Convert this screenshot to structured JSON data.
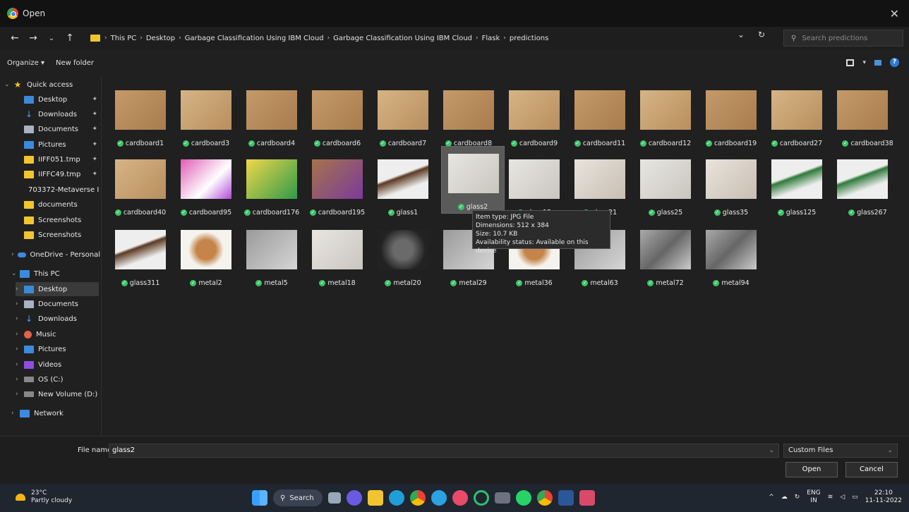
{
  "window": {
    "title": "Open"
  },
  "breadcrumb": {
    "segments": [
      "This PC",
      "Desktop",
      "Garbage Classification Using IBM Cloud",
      "Garbage Classification Using IBM Cloud",
      "Flask",
      "predictions"
    ]
  },
  "search": {
    "placeholder": "Search predictions"
  },
  "toolbar": {
    "organize": "Organize ▾",
    "new_folder": "New folder"
  },
  "sidebar": {
    "items": [
      {
        "label": "Quick access",
        "icon": "star-icon"
      },
      {
        "label": "Desktop",
        "icon": "desktop-icon",
        "pinned": true
      },
      {
        "label": "Downloads",
        "icon": "download-icon",
        "pinned": true
      },
      {
        "label": "Documents",
        "icon": "documents-icon",
        "pinned": true
      },
      {
        "label": "Pictures",
        "icon": "pictures-icon",
        "pinned": true
      },
      {
        "label": "IIFF051.tmp",
        "icon": "folder-icon",
        "pinned": true
      },
      {
        "label": "IIFFC49.tmp",
        "icon": "folder-icon",
        "pinned": true
      },
      {
        "label": "703372-Metaverse I",
        "icon": "folder-icon"
      },
      {
        "label": "documents",
        "icon": "folder-icon"
      },
      {
        "label": "Screenshots",
        "icon": "folder-icon"
      },
      {
        "label": "Screenshots",
        "icon": "folder-icon"
      },
      {
        "label": "OneDrive - Personal",
        "icon": "cloud-icon"
      },
      {
        "label": "This PC",
        "icon": "pc-icon"
      },
      {
        "label": "Desktop",
        "icon": "desktop-icon"
      },
      {
        "label": "Documents",
        "icon": "documents-icon"
      },
      {
        "label": "Downloads",
        "icon": "download-icon"
      },
      {
        "label": "Music",
        "icon": "music-icon"
      },
      {
        "label": "Pictures",
        "icon": "pictures-icon"
      },
      {
        "label": "Videos",
        "icon": "videos-icon"
      },
      {
        "label": "OS (C:)",
        "icon": "drive-icon"
      },
      {
        "label": "New Volume (D:)",
        "icon": "drive-icon"
      },
      {
        "label": "Network",
        "icon": "network-icon"
      }
    ]
  },
  "files": [
    "cardboard1",
    "cardboard3",
    "cardboard4",
    "cardboard6",
    "cardboard7",
    "cardboard8",
    "cardboard9",
    "cardboard11",
    "cardboard12",
    "cardboard19",
    "cardboard27",
    "cardboard38",
    "cardboard40",
    "cardboard95",
    "cardboard176",
    "cardboard195",
    "glass1",
    "glass2",
    "glass12",
    "glass21",
    "glass25",
    "glass35",
    "glass125",
    "glass267",
    "glass311",
    "metal2",
    "metal5",
    "metal18",
    "metal20",
    "metal29",
    "metal36",
    "metal63",
    "metal72",
    "metal94"
  ],
  "tooltip": {
    "type": "Item type: JPG File",
    "dimensions": "Dimensions: 512 x 384",
    "size": "Size: 10.7 KB",
    "availability": "Availability status: Available on this device"
  },
  "footer": {
    "file_name_label": "File name:",
    "file_name_value": "glass2",
    "file_type": "Custom Files",
    "open": "Open",
    "cancel": "Cancel"
  },
  "taskbar": {
    "temperature": "23°C",
    "weather": "Partly cloudy",
    "search": "Search",
    "lang_top": "ENG",
    "lang_bottom": "IN",
    "time": "22:10",
    "date": "11-11-2022"
  }
}
